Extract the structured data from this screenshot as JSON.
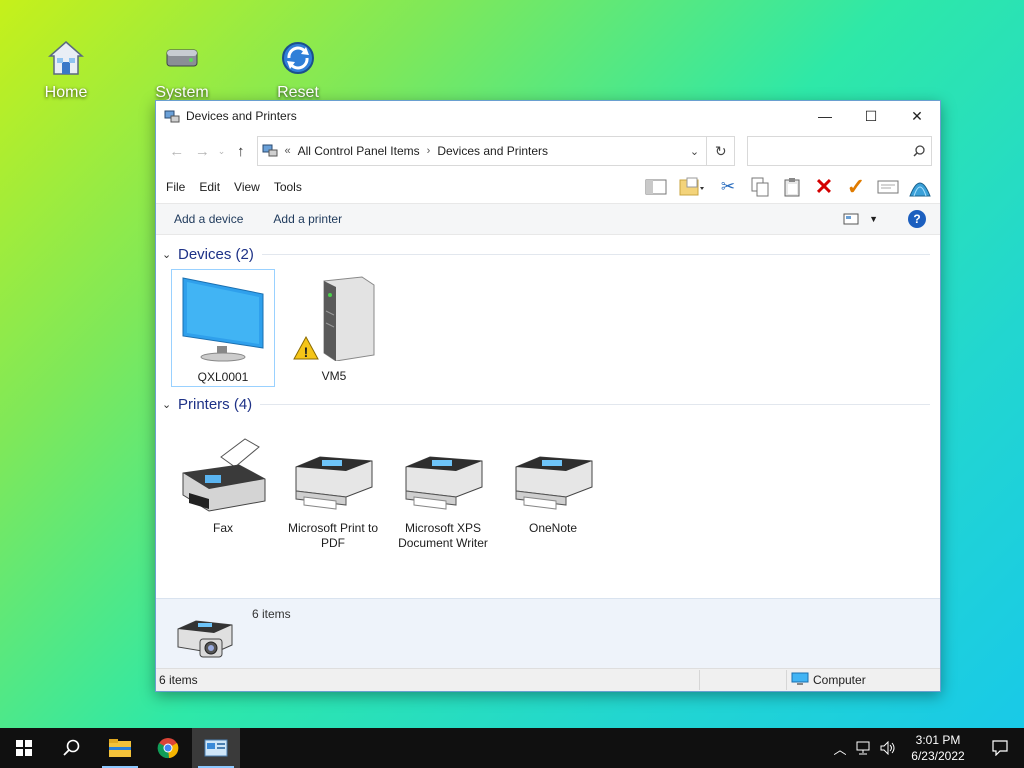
{
  "desktop": {
    "icons": [
      {
        "label": "Home"
      },
      {
        "label": "System"
      },
      {
        "label": "Reset"
      }
    ]
  },
  "window": {
    "title": "Devices and Printers",
    "controls": {
      "minimize": "—",
      "maximize": "☐",
      "close": "✕"
    },
    "address": {
      "overflow": "«",
      "crumbs": [
        "All Control Panel Items",
        "Devices and Printers"
      ],
      "separator": "›"
    },
    "search": {
      "placeholder": ""
    },
    "menu": [
      "File",
      "Edit",
      "View",
      "Tools"
    ],
    "commands": [
      "Add a device",
      "Add a printer"
    ],
    "groups": {
      "devices": {
        "header": "Devices (2)",
        "items": [
          {
            "label": "QXL0001",
            "icon": "monitor-icon",
            "selected": true
          },
          {
            "label": "VM5",
            "icon": "server-tower-icon",
            "warning": true
          }
        ]
      },
      "printers": {
        "header": "Printers (4)",
        "items": [
          {
            "label": "Fax",
            "icon": "fax-icon"
          },
          {
            "label": "Microsoft Print to PDF",
            "icon": "printer-icon"
          },
          {
            "label": "Microsoft XPS Document Writer",
            "icon": "printer-icon"
          },
          {
            "label": "OneNote",
            "icon": "printer-icon"
          }
        ]
      }
    },
    "details": {
      "count": "6 items",
      "icon": "printer-camera-icon"
    },
    "status": {
      "left": "6 items",
      "right": "Computer"
    }
  },
  "taskbar": {
    "clock": {
      "time": "3:01 PM",
      "date": "6/23/2022"
    },
    "apps": [
      "start-icon",
      "search-icon",
      "file-explorer-icon",
      "chrome-icon",
      "control-panel-icon"
    ]
  },
  "colors": {
    "accent": "#0078d7",
    "group_header": "#1e3287",
    "selection_border": "#99d1ff",
    "delete_red": "#d40000",
    "check_orange": "#e07b00"
  }
}
